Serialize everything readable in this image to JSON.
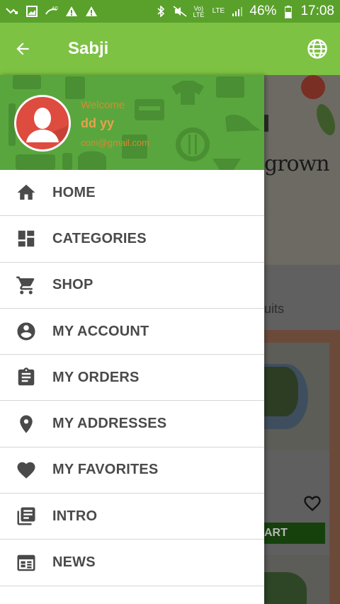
{
  "status_bar": {
    "battery": "46%",
    "time": "17:08",
    "network_1": "Vo) LTE",
    "network_2": "LTE"
  },
  "app_bar": {
    "title": "Sabji",
    "back_icon": "arrow-back-icon",
    "globe_icon": "globe-icon"
  },
  "drawer": {
    "header": {
      "welcome": "Welcome",
      "name": "dd yy",
      "email": "com@gmail.com"
    },
    "items": [
      {
        "label": "HOME",
        "icon": "home-icon"
      },
      {
        "label": "CATEGORIES",
        "icon": "dashboard-icon"
      },
      {
        "label": "SHOP",
        "icon": "cart-icon"
      },
      {
        "label": "MY ACCOUNT",
        "icon": "account-circle-icon"
      },
      {
        "label": "MY ORDERS",
        "icon": "clipboard-icon"
      },
      {
        "label": "MY ADDRESSES",
        "icon": "location-pin-icon"
      },
      {
        "label": "MY FAVORITES",
        "icon": "heart-icon"
      },
      {
        "label": "INTRO",
        "icon": "library-books-icon"
      },
      {
        "label": "NEWS",
        "icon": "news-icon"
      }
    ]
  },
  "background": {
    "banner_text": "grown",
    "section_text": "uits",
    "cart_button": "ART"
  },
  "colors": {
    "status_bar": "#5aa12c",
    "app_bar": "#7dc243",
    "drawer_header": "#5aa63e",
    "avatar": "#de4b3f",
    "menu_text": "#4a4a4a"
  }
}
